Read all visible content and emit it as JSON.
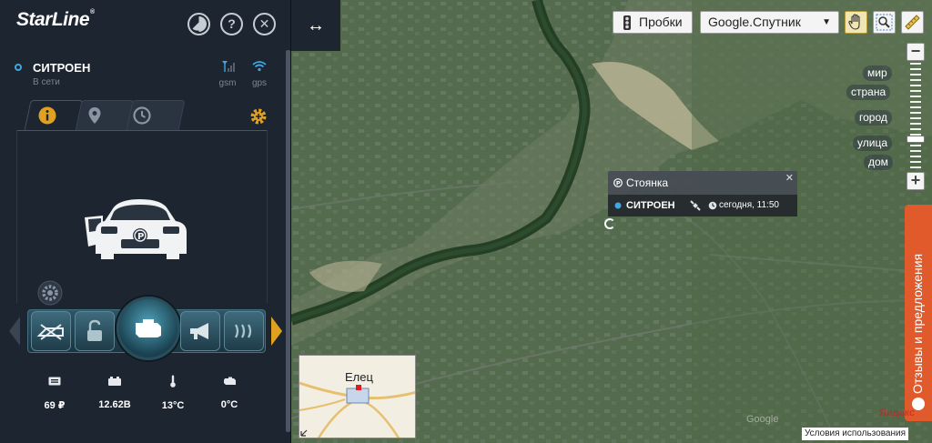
{
  "sidebar": {
    "brand": "StarLine",
    "brand_mark": "®",
    "help_label": "?",
    "close_label": "✕",
    "vehicle": {
      "name": "СИТРОЕН",
      "status": "В сети",
      "gsm_label": "gsm",
      "gps_label": "gps"
    },
    "tabs": [
      {
        "icon": "info-icon",
        "active": true
      },
      {
        "icon": "map-pin-icon",
        "active": false
      },
      {
        "icon": "clock-icon",
        "active": false
      }
    ],
    "stats": [
      {
        "icon": "balance-icon",
        "value": "69 ₽"
      },
      {
        "icon": "battery-icon",
        "value": "12.62В"
      },
      {
        "icon": "thermometer-icon",
        "value": "13°C"
      },
      {
        "icon": "engine-icon",
        "value": "0°C"
      }
    ]
  },
  "map": {
    "expand_label": "↔",
    "traffic_label": "Пробки",
    "layer_select": "Google.Спутник",
    "zoom_labels": [
      "мир",
      "страна",
      "город",
      "улица",
      "дом"
    ],
    "zoom_in": "+",
    "zoom_out": "−",
    "popup": {
      "title": "Стоянка",
      "car": "СИТРОЕН",
      "time": "сегодня, 11:50"
    },
    "feedback": "Отзывы и предложения",
    "minimap_city": "Елец",
    "terms": "Условия использования",
    "watermark": "Яндекс",
    "watermark2": "Google"
  },
  "colors": {
    "sidebar_bg": "#1d2530",
    "accent_orange": "#e0a020",
    "feedback_orange": "#e05a2b",
    "status_blue": "#3fa8e0"
  }
}
